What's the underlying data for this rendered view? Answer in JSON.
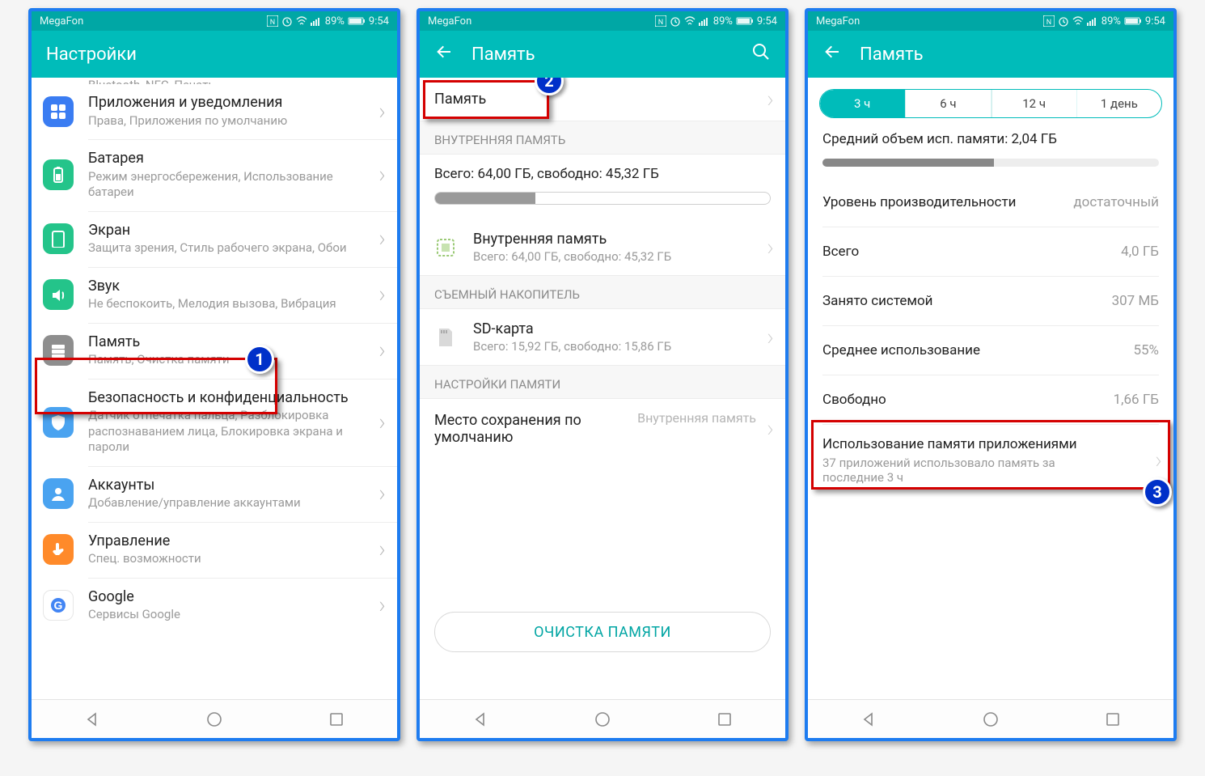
{
  "status": {
    "carrier": "MegaFon",
    "battery_pct": "89%",
    "time": "9:54"
  },
  "colors": {
    "accent": "#00bcba",
    "badge_blue": "#0030c9",
    "highlight_red": "#d40000"
  },
  "screen1": {
    "title": "Настройки",
    "cutoff_sub": "Bluetooth, NFC, Печать",
    "items": [
      {
        "title": "Приложения и уведомления",
        "sub": "Права, Приложения по умолчанию",
        "icon_bg": "#3a7cf2",
        "svg": "apps"
      },
      {
        "title": "Батарея",
        "sub": "Режим энергосбережения, Использование батареи",
        "icon_bg": "#24c48a",
        "svg": "battery"
      },
      {
        "title": "Экран",
        "sub": "Защита зрения, Стиль рабочего экрана, Обои",
        "icon_bg": "#24c48a",
        "svg": "display"
      },
      {
        "title": "Звук",
        "sub": "Не беспокоить, Мелодия вызова, Вибрация",
        "icon_bg": "#24c48a",
        "svg": "sound"
      },
      {
        "title": "Память",
        "sub": "Память, Очистка памяти",
        "icon_bg": "#8e8e8e",
        "svg": "storage"
      },
      {
        "title": "Безопасность и конфиденциальность",
        "sub": "Датчик отпечатка пальца, Разблокировка распознаванием лица, Блокировка экрана и пароли",
        "icon_bg": "#4aa3f0",
        "svg": "shield"
      },
      {
        "title": "Аккаунты",
        "sub": "Добавление/управление аккаунтами",
        "icon_bg": "#4aa3f0",
        "svg": "account"
      },
      {
        "title": "Управление",
        "sub": "Спец. возможности",
        "icon_bg": "#ff8a2a",
        "svg": "hand"
      },
      {
        "title": "Google",
        "sub": "Сервисы Google",
        "icon_bg": "#ffffff",
        "svg": "google"
      }
    ],
    "badge": "1"
  },
  "screen2": {
    "title": "Память",
    "ram_row": "Память",
    "sec_internal": "ВНУТРЕННЯЯ ПАМЯТЬ",
    "summary": "Всего: 64,00 ГБ, свободно: 45,32 ГБ",
    "summary_fill_pct": 30,
    "internal": {
      "t": "Внутренняя память",
      "s": "Всего: 64,00 ГБ, свободно: 45,32 ГБ"
    },
    "sec_removable": "СЪЕМНЫЙ НАКОПИТЕЛЬ",
    "sd": {
      "t": "SD-карта",
      "s": "Всего: 15,92 ГБ, свободно: 15,86 ГБ"
    },
    "sec_settings": "НАСТРОЙКИ ПАМЯТИ",
    "default_loc": {
      "l": "Место сохранения по умолчанию",
      "r": "Внутренняя память"
    },
    "clean_btn": "ОЧИСТКА ПАМЯТИ",
    "badge": "2"
  },
  "screen3": {
    "title": "Память",
    "tabs": [
      "3 ч",
      "6 ч",
      "12 ч",
      "1 день"
    ],
    "active_tab": 0,
    "avg_line": "Средний объем исп. памяти: 2,04 ГБ",
    "mem_fill_pct": 51,
    "rows": [
      {
        "k": "Уровень производительности",
        "v": "достаточный"
      },
      {
        "k": "Всего",
        "v": "4,0 ГБ"
      },
      {
        "k": "Занято системой",
        "v": "307 МБ"
      },
      {
        "k": "Среднее использование",
        "v": "55%"
      },
      {
        "k": "Свободно",
        "v": "1,66 ГБ"
      }
    ],
    "apps": {
      "t": "Использование памяти приложениями",
      "s": "37 приложений использовало память за последние 3 ч"
    },
    "badge": "3"
  }
}
